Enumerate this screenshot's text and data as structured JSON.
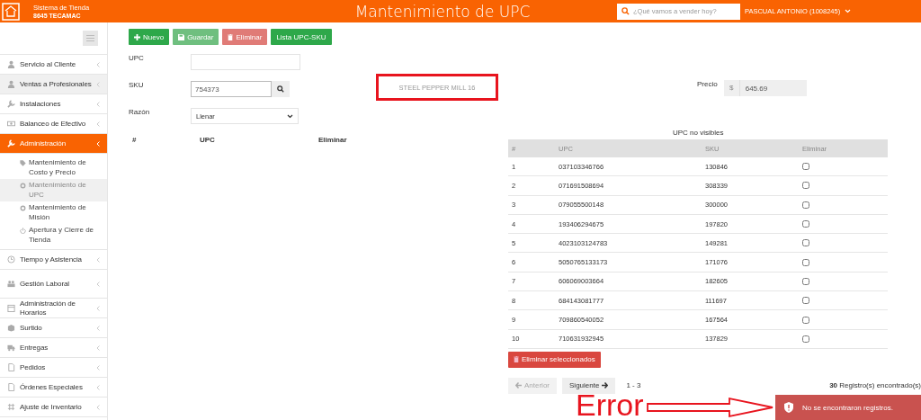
{
  "header": {
    "brand_title": "Sistema de Tienda",
    "brand_store": "8645 TECAMAC",
    "title": "Mantenimiento de UPC",
    "search": {
      "placeholder": "¿Qué vamos a vender hoy?"
    },
    "user": "PASCUAL ANTONIO (1008245)"
  },
  "sidebar": {
    "items": [
      {
        "label": "Servicio al Cliente",
        "selected": false,
        "hovered": false
      },
      {
        "label": "Ventas a Profesionales",
        "selected": false,
        "hovered": true
      },
      {
        "label": "Instalaciones",
        "selected": false,
        "hovered": false
      },
      {
        "label": "Balanceo de Efectivo",
        "selected": false,
        "hovered": false
      },
      {
        "label": "Administración",
        "selected": true,
        "hovered": false,
        "children": [
          {
            "label": "Mantenimiento de Costo y Precio",
            "selected": false
          },
          {
            "label": "Mantenimiento de UPC",
            "selected": true
          },
          {
            "label": "Mantenimiento de Misión",
            "selected": false
          },
          {
            "label": "Apertura y Cierre de Tienda",
            "selected": false
          }
        ]
      },
      {
        "label": "Tiempo y Asistencia",
        "selected": false,
        "hovered": false
      },
      {
        "label": "Gestión Laboral",
        "selected": false,
        "hovered": false
      },
      {
        "label": "Administración de Horarios",
        "selected": false,
        "hovered": false
      },
      {
        "label": "Surtido",
        "selected": false,
        "hovered": false
      },
      {
        "label": "Entregas",
        "selected": false,
        "hovered": false
      },
      {
        "label": "Pedidos",
        "selected": false,
        "hovered": false
      },
      {
        "label": "Órdenes Especiales",
        "selected": false,
        "hovered": false
      },
      {
        "label": "Ajuste de Inventario",
        "selected": false,
        "hovered": false
      }
    ]
  },
  "toolbar": [
    {
      "label": "Nuevo",
      "kind": "success",
      "disabled": false
    },
    {
      "label": "Guardar",
      "kind": "success",
      "disabled": true
    },
    {
      "label": "Eliminar",
      "kind": "danger",
      "disabled": true
    },
    {
      "label": "Lista UPC-SKU",
      "kind": "success",
      "disabled": false
    }
  ],
  "form": {
    "upc": {
      "label": "UPC"
    },
    "sku": {
      "label": "SKU",
      "value": "754373"
    },
    "reason": {
      "label": "Razón",
      "value": "Llenar"
    },
    "description": "STEEL PEPPER MILL 16",
    "price": {
      "label": "Precio",
      "prefix": "$",
      "value": "645.69"
    }
  },
  "left_table": {
    "columns": [
      "#",
      "UPC",
      "Eliminar"
    ]
  },
  "right_table": {
    "title": "UPC no visibles",
    "columns": [
      "#",
      "UPC",
      "SKU",
      "Eliminar"
    ],
    "rows": [
      {
        "num": "1",
        "upc": "037103346766",
        "sku": "130846",
        "checked": false
      },
      {
        "num": "2",
        "upc": "071691508694",
        "sku": "308339",
        "checked": false
      },
      {
        "num": "3",
        "upc": "079055500148",
        "sku": "300000",
        "checked": false
      },
      {
        "num": "4",
        "upc": "193406294675",
        "sku": "197820",
        "checked": false
      },
      {
        "num": "5",
        "upc": "4023103124783",
        "sku": "149281",
        "checked": false
      },
      {
        "num": "6",
        "upc": "5050765133173",
        "sku": "171076",
        "checked": false
      },
      {
        "num": "7",
        "upc": "606069003664",
        "sku": "182605",
        "checked": false
      },
      {
        "num": "8",
        "upc": "684143081777",
        "sku": "111697",
        "checked": false
      },
      {
        "num": "9",
        "upc": "709860540052",
        "sku": "167564",
        "checked": false
      },
      {
        "num": "10",
        "upc": "710631932945",
        "sku": "137829",
        "checked": false
      }
    ]
  },
  "delete_selected": "Eliminar seleccionados",
  "pagination": {
    "previous": {
      "label": "Anterior",
      "disabled": true
    },
    "next": {
      "label": "Siguiente",
      "disabled": false
    },
    "range": "1 - 3",
    "total": "**30** Registro(s) encontrado(s)"
  },
  "toast": {
    "message": "No se encontraron registros."
  },
  "annotation": {
    "label": "Error"
  }
}
